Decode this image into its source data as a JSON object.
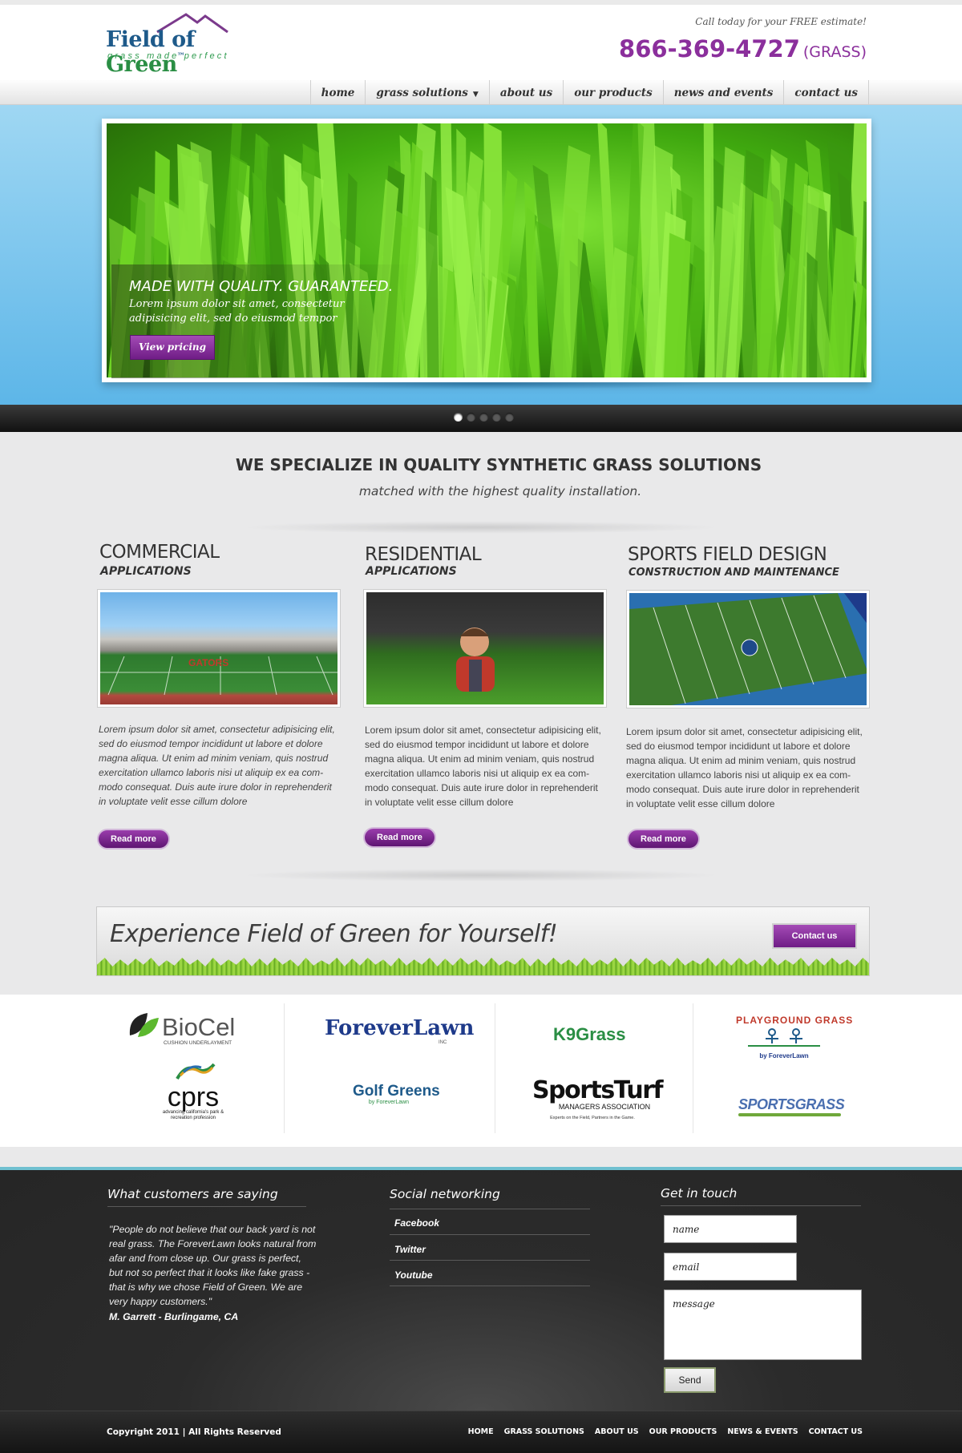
{
  "header": {
    "logo_text_a": "Field of ",
    "logo_text_b": "Green",
    "logo_tm": "™",
    "logo_tagline": "grass made perfect",
    "tagline": "Call today for your FREE estimate!",
    "phone": "866-369-4727",
    "phone_suffix": "(GRASS)"
  },
  "nav": [
    {
      "label": "home"
    },
    {
      "label": "grass solutions",
      "has_dropdown": true
    },
    {
      "label": "about us"
    },
    {
      "label": "our products"
    },
    {
      "label": "news and events"
    },
    {
      "label": "contact us"
    }
  ],
  "hero": {
    "title": "MADE WITH QUALITY. GUARANTEED.",
    "text": "Lorem ipsum dolor sit amet, consectetur adipisicing elit, sed do eiusmod tempor",
    "button": "View pricing",
    "slides_total": 5,
    "active_slide": 1
  },
  "specialize": {
    "title": "WE SPECIALIZE IN QUALITY SYNTHETIC GRASS SOLUTIONS",
    "subtitle": "matched with the highest quality installation."
  },
  "columns": [
    {
      "heading": "COMMERCIAL",
      "subheading": "APPLICATIONS",
      "text": "Lorem ipsum dolor sit amet, consectetur adipisicing elit, sed do eiusmod tempor incididunt ut labore et dolore magna aliqua. Ut enim ad minim veniam, quis nostrud exercitation ullamco laboris nisi ut aliquip ex ea com-modo consequat. Duis aute irure dolor in reprehenderit in voluptate velit esse cillum dolore",
      "button": "Read more"
    },
    {
      "heading": "RESIDENTIAL",
      "subheading": "APPLICATIONS",
      "text": "Lorem ipsum dolor sit amet, consectetur adipisicing elit, sed do eiusmod tempor incididunt ut labore et dolore magna aliqua. Ut enim ad minim veniam, quis nostrud exercitation ullamco laboris nisi ut aliquip ex ea com-modo consequat. Duis aute irure dolor in reprehenderit in voluptate velit esse cillum dolore",
      "button": "Read more"
    },
    {
      "heading": "SPORTS FIELD DESIGN",
      "subheading": "CONSTRUCTION AND MAINTENANCE",
      "text": "Lorem ipsum dolor sit amet, consectetur adipisicing elit, sed do eiusmod tempor incididunt ut labore et dolore magna aliqua. Ut enim ad minim veniam, quis nostrud exercitation ullamco laboris nisi ut aliquip ex ea com-modo consequat. Duis aute irure dolor in reprehenderit in voluptate velit esse cillum dolore",
      "button": "Read more"
    }
  ],
  "experience": {
    "text": "Experience Field of Green for Yourself!",
    "button": "Contact us"
  },
  "partners": {
    "biocel": "BioCel",
    "biocel_sub": "CUSHION UNDERLAYMENT",
    "foreverlawn": "ForeverLawn",
    "foreverlawn_sub": "INC",
    "k9grass": "K9Grass",
    "playground": "PLAYGROUND GRASS",
    "playground_sub": "by ForeverLawn",
    "cprs": "cprs",
    "cprs_sub": "advancing california's park & recreation profession",
    "golfgreens": "Golf Greens",
    "golfgreens_sub": "by ForeverLawn",
    "sportsturf": "SportsTurf",
    "sportsturf_sub": "MANAGERS ASSOCIATION",
    "sportsturf_tag": "Experts on the Field, Partners in the Game.",
    "sportsgrass": "SPORTSGRASS"
  },
  "footer": {
    "testimonial_heading": "What customers are saying",
    "quote": "\"People do not believe that our back yard is not real grass. The ForeverLawn looks natural from afar and from close up. Our grass is perfect, but not so perfect that it looks like fake grass - that is why we chose Field of Green. We are very happy customers.\"",
    "quote_author": "M. Garrett - Burlingame, CA",
    "social_heading": "Social networking",
    "social_links": [
      "Facebook",
      "Twitter",
      "Youtube"
    ],
    "contact_heading": "Get in touch",
    "name_placeholder": "name",
    "email_placeholder": "email",
    "message_placeholder": "message",
    "send_label": "Send",
    "copyright": "Copyright 2011 | All Rights Reserved",
    "nav": [
      "HOME",
      "GRASS SOLUTIONS",
      "ABOUT US",
      "OUR PRODUCTS",
      "NEWS & EVENTS",
      "CONTACT US"
    ]
  },
  "colors": {
    "brand_purple": "#8b2f9c",
    "brand_green": "#2a8e44",
    "brand_blue": "#1e5a8a",
    "sky_blue": "#5db6e8"
  }
}
